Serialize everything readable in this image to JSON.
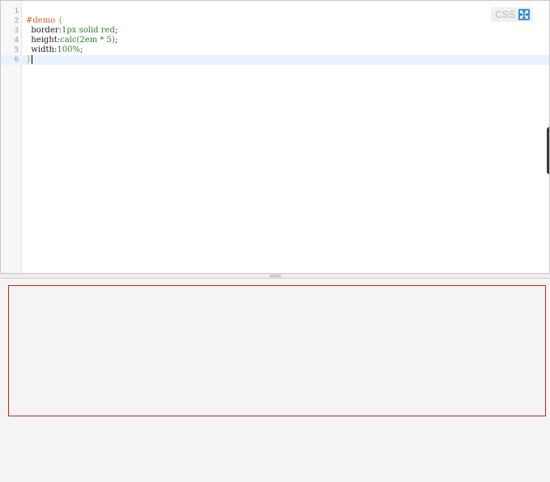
{
  "editor": {
    "language_label": "CSS",
    "expand_icon": "expand-arrows-icon",
    "lines": [
      {
        "num": "1",
        "tokens": []
      },
      {
        "num": "2",
        "tokens": [
          {
            "text": "#demo",
            "type": "selector"
          },
          {
            "text": " {",
            "type": "brace"
          }
        ]
      },
      {
        "num": "3",
        "tokens": [
          {
            "text": "  border",
            "type": "prop"
          },
          {
            "text": ":",
            "type": "punct"
          },
          {
            "text": "1px solid red",
            "type": "value"
          },
          {
            "text": ";",
            "type": "punct"
          }
        ]
      },
      {
        "num": "4",
        "tokens": [
          {
            "text": "  height",
            "type": "prop"
          },
          {
            "text": ":",
            "type": "punct"
          },
          {
            "text": "calc(2em * 5)",
            "type": "value"
          },
          {
            "text": ";",
            "type": "punct"
          }
        ]
      },
      {
        "num": "5",
        "tokens": [
          {
            "text": "  width",
            "type": "prop"
          },
          {
            "text": ":",
            "type": "punct"
          },
          {
            "text": "100%",
            "type": "value"
          },
          {
            "text": ";",
            "type": "punct"
          }
        ]
      },
      {
        "num": "6",
        "tokens": [
          {
            "text": "}",
            "type": "brace"
          }
        ],
        "active": true
      }
    ]
  },
  "preview": {
    "demo_border_color": "#d42020"
  },
  "colors": {
    "selector": "#d2691e",
    "brace": "#7ab648",
    "value": "#2e7d32",
    "active_line": "#e8f2fe",
    "icon_blue": "#3b8fd9"
  }
}
